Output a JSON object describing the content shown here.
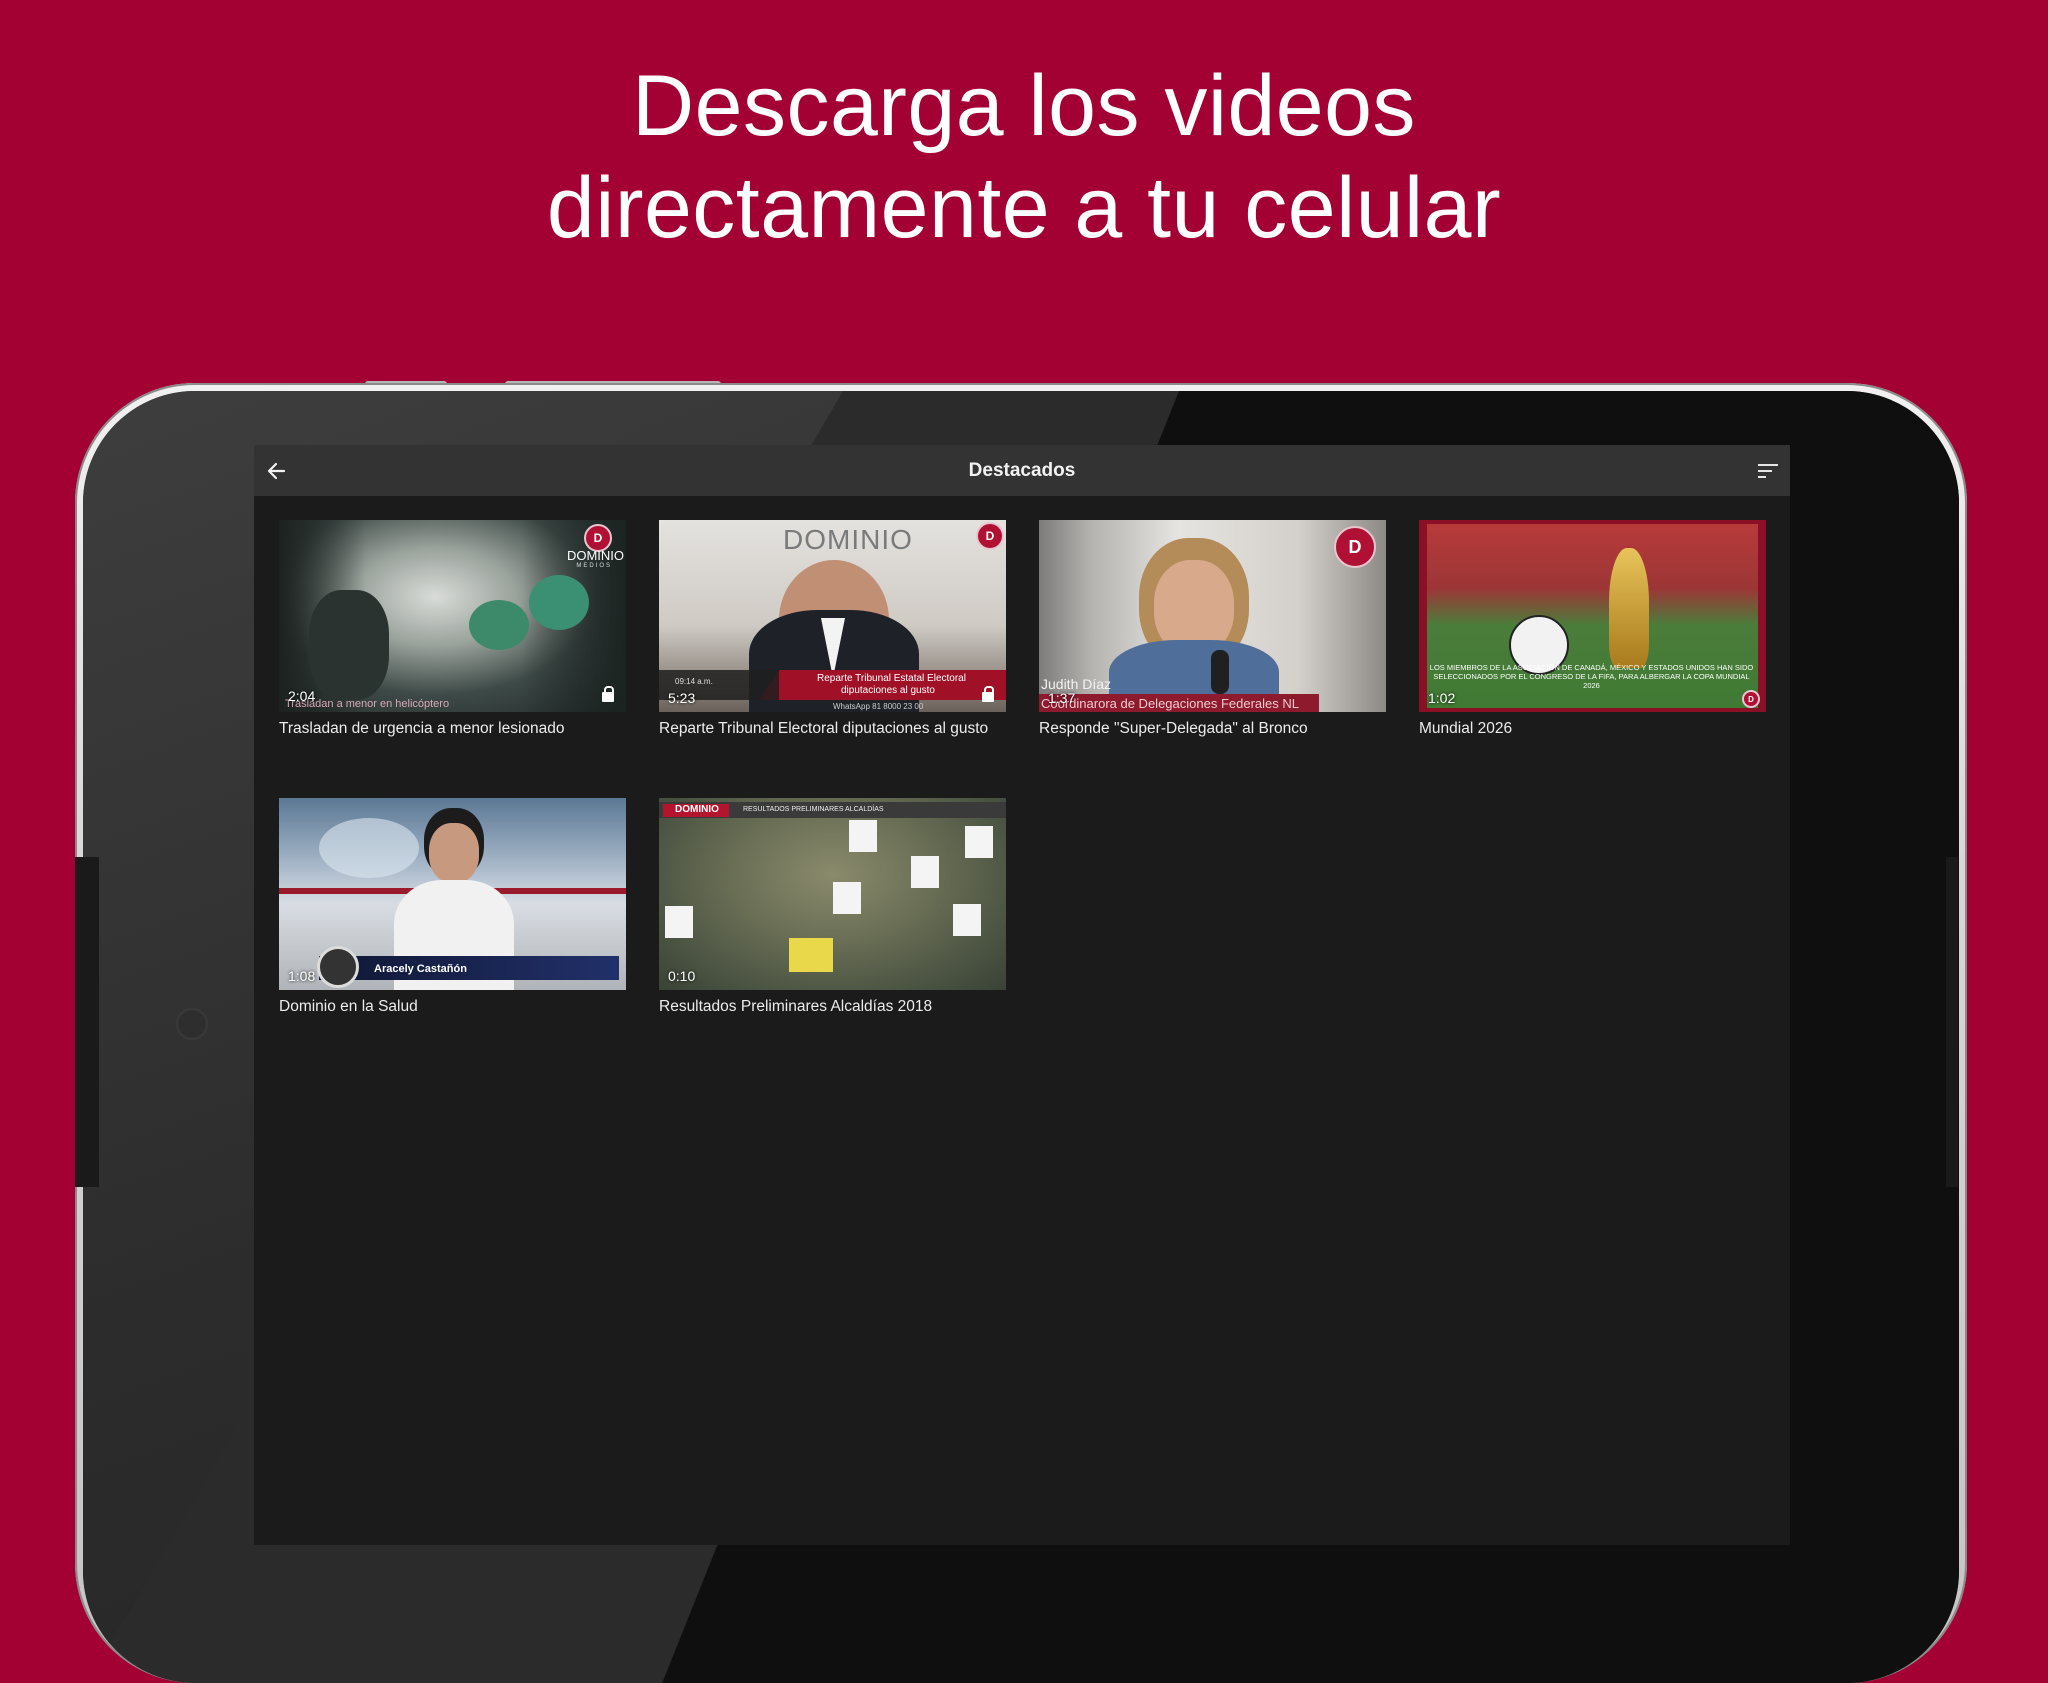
{
  "headline": {
    "line1": "Descarga los videos",
    "line2": "directamente a tu celular"
  },
  "colors": {
    "background": "#a30034",
    "appbar": "#333333",
    "screen": "#1b1b1b",
    "text": "#ececec"
  },
  "appbar": {
    "title": "Destacados",
    "back_icon": "arrow-left-icon",
    "sort_icon": "sort-icon"
  },
  "videos": [
    {
      "duration": "2:04",
      "title": "Trasladan de urgencia a menor lesionado",
      "locked": true,
      "brand": "DOMINIO",
      "brand_sub": "MEDIOS",
      "caption": "Trasladan a menor en helicóptero"
    },
    {
      "duration": "5:23",
      "title": "Reparte Tribunal Electoral diputaciones al gusto",
      "locked": true,
      "brand": "DOMINIO",
      "time_badge": "09:14 a.m.",
      "caption_line1": "Reparte Tribunal Estatal Electoral",
      "caption_line2": "diputaciones al gusto",
      "whatsapp": "WhatsApp 81 8000 23 00"
    },
    {
      "duration": "1:37",
      "title": "Responde \"Super-Delegada\" al Bronco",
      "locked": false,
      "name_tag": "Judith Díaz",
      "role_tag": "Coordinarora de Delegaciones Federales NL"
    },
    {
      "duration": "1:02",
      "title": "Mundial 2026",
      "locked": false,
      "caption": "LOS MIEMBROS DE LA ASOCIACIÓN DE CANADÁ, MÉXICO Y ESTADOS UNIDOS HAN SIDO SELECCIONADOS POR EL CONGRESO DE LA FIFA, PARA ALBERGAR LA COPA MUNDIAL 2026"
    },
    {
      "duration": "1:08",
      "title": "Dominio en la Salud",
      "locked": false,
      "name_tag": "Aracely Castañón"
    },
    {
      "duration": "0:10",
      "title": "Resultados Preliminares Alcaldías 2018",
      "locked": false,
      "brand": "DOMINIO",
      "banner": "RESULTADOS PRELIMINARES ALCALDÍAS"
    }
  ]
}
